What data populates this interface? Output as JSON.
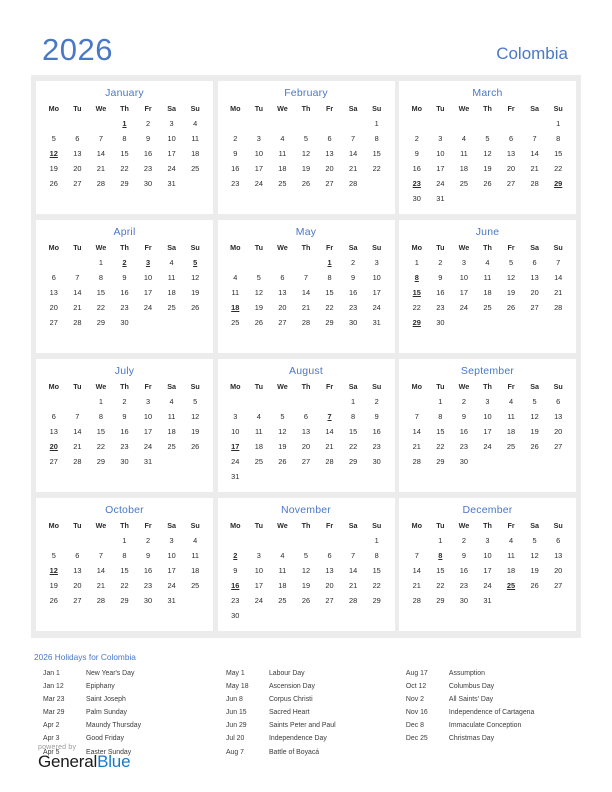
{
  "header": {
    "year": "2026",
    "country": "Colombia"
  },
  "weekdays": [
    "Mo",
    "Tu",
    "We",
    "Th",
    "Fr",
    "Sa",
    "Su"
  ],
  "months": [
    {
      "name": "January",
      "weeks": [
        [
          "",
          "",
          "",
          "1",
          "2",
          "3",
          "4"
        ],
        [
          "5",
          "6",
          "7",
          "8",
          "9",
          "10",
          "11"
        ],
        [
          "12",
          "13",
          "14",
          "15",
          "16",
          "17",
          "18"
        ],
        [
          "19",
          "20",
          "21",
          "22",
          "23",
          "24",
          "25"
        ],
        [
          "26",
          "27",
          "28",
          "29",
          "30",
          "31",
          ""
        ],
        [
          "",
          "",
          "",
          "",
          "",
          "",
          ""
        ]
      ],
      "holidays": [
        "1",
        "12"
      ]
    },
    {
      "name": "February",
      "weeks": [
        [
          "",
          "",
          "",
          "",
          "",
          "",
          "1"
        ],
        [
          "2",
          "3",
          "4",
          "5",
          "6",
          "7",
          "8"
        ],
        [
          "9",
          "10",
          "11",
          "12",
          "13",
          "14",
          "15"
        ],
        [
          "16",
          "17",
          "18",
          "19",
          "20",
          "21",
          "22"
        ],
        [
          "23",
          "24",
          "25",
          "26",
          "27",
          "28",
          ""
        ],
        [
          "",
          "",
          "",
          "",
          "",
          "",
          ""
        ]
      ],
      "holidays": []
    },
    {
      "name": "March",
      "weeks": [
        [
          "",
          "",
          "",
          "",
          "",
          "",
          "1"
        ],
        [
          "2",
          "3",
          "4",
          "5",
          "6",
          "7",
          "8"
        ],
        [
          "9",
          "10",
          "11",
          "12",
          "13",
          "14",
          "15"
        ],
        [
          "16",
          "17",
          "18",
          "19",
          "20",
          "21",
          "22"
        ],
        [
          "23",
          "24",
          "25",
          "26",
          "27",
          "28",
          "29"
        ],
        [
          "30",
          "31",
          "",
          "",
          "",
          "",
          ""
        ]
      ],
      "holidays": [
        "23",
        "29"
      ]
    },
    {
      "name": "April",
      "weeks": [
        [
          "",
          "",
          "1",
          "2",
          "3",
          "4",
          "5"
        ],
        [
          "6",
          "7",
          "8",
          "9",
          "10",
          "11",
          "12"
        ],
        [
          "13",
          "14",
          "15",
          "16",
          "17",
          "18",
          "19"
        ],
        [
          "20",
          "21",
          "22",
          "23",
          "24",
          "25",
          "26"
        ],
        [
          "27",
          "28",
          "29",
          "30",
          "",
          "",
          ""
        ],
        [
          "",
          "",
          "",
          "",
          "",
          "",
          ""
        ]
      ],
      "holidays": [
        "2",
        "3",
        "5"
      ]
    },
    {
      "name": "May",
      "weeks": [
        [
          "",
          "",
          "",
          "",
          "1",
          "2",
          "3"
        ],
        [
          "4",
          "5",
          "6",
          "7",
          "8",
          "9",
          "10"
        ],
        [
          "11",
          "12",
          "13",
          "14",
          "15",
          "16",
          "17"
        ],
        [
          "18",
          "19",
          "20",
          "21",
          "22",
          "23",
          "24"
        ],
        [
          "25",
          "26",
          "27",
          "28",
          "29",
          "30",
          "31"
        ],
        [
          "",
          "",
          "",
          "",
          "",
          "",
          ""
        ]
      ],
      "holidays": [
        "1",
        "18"
      ]
    },
    {
      "name": "June",
      "weeks": [
        [
          "1",
          "2",
          "3",
          "4",
          "5",
          "6",
          "7"
        ],
        [
          "8",
          "9",
          "10",
          "11",
          "12",
          "13",
          "14"
        ],
        [
          "15",
          "16",
          "17",
          "18",
          "19",
          "20",
          "21"
        ],
        [
          "22",
          "23",
          "24",
          "25",
          "26",
          "27",
          "28"
        ],
        [
          "29",
          "30",
          "",
          "",
          "",
          "",
          ""
        ],
        [
          "",
          "",
          "",
          "",
          "",
          "",
          ""
        ]
      ],
      "holidays": [
        "8",
        "15",
        "29"
      ]
    },
    {
      "name": "July",
      "weeks": [
        [
          "",
          "",
          "1",
          "2",
          "3",
          "4",
          "5"
        ],
        [
          "6",
          "7",
          "8",
          "9",
          "10",
          "11",
          "12"
        ],
        [
          "13",
          "14",
          "15",
          "16",
          "17",
          "18",
          "19"
        ],
        [
          "20",
          "21",
          "22",
          "23",
          "24",
          "25",
          "26"
        ],
        [
          "27",
          "28",
          "29",
          "30",
          "31",
          "",
          ""
        ],
        [
          "",
          "",
          "",
          "",
          "",
          "",
          ""
        ]
      ],
      "holidays": [
        "20"
      ]
    },
    {
      "name": "August",
      "weeks": [
        [
          "",
          "",
          "",
          "",
          "",
          "1",
          "2"
        ],
        [
          "3",
          "4",
          "5",
          "6",
          "7",
          "8",
          "9"
        ],
        [
          "10",
          "11",
          "12",
          "13",
          "14",
          "15",
          "16"
        ],
        [
          "17",
          "18",
          "19",
          "20",
          "21",
          "22",
          "23"
        ],
        [
          "24",
          "25",
          "26",
          "27",
          "28",
          "29",
          "30"
        ],
        [
          "31",
          "",
          "",
          "",
          "",
          "",
          ""
        ]
      ],
      "holidays": [
        "7",
        "17"
      ]
    },
    {
      "name": "September",
      "weeks": [
        [
          "",
          "1",
          "2",
          "3",
          "4",
          "5",
          "6"
        ],
        [
          "7",
          "8",
          "9",
          "10",
          "11",
          "12",
          "13"
        ],
        [
          "14",
          "15",
          "16",
          "17",
          "18",
          "19",
          "20"
        ],
        [
          "21",
          "22",
          "23",
          "24",
          "25",
          "26",
          "27"
        ],
        [
          "28",
          "29",
          "30",
          "",
          "",
          "",
          ""
        ],
        [
          "",
          "",
          "",
          "",
          "",
          "",
          ""
        ]
      ],
      "holidays": []
    },
    {
      "name": "October",
      "weeks": [
        [
          "",
          "",
          "",
          "1",
          "2",
          "3",
          "4"
        ],
        [
          "5",
          "6",
          "7",
          "8",
          "9",
          "10",
          "11"
        ],
        [
          "12",
          "13",
          "14",
          "15",
          "16",
          "17",
          "18"
        ],
        [
          "19",
          "20",
          "21",
          "22",
          "23",
          "24",
          "25"
        ],
        [
          "26",
          "27",
          "28",
          "29",
          "30",
          "31",
          ""
        ],
        [
          "",
          "",
          "",
          "",
          "",
          "",
          ""
        ]
      ],
      "holidays": [
        "12"
      ]
    },
    {
      "name": "November",
      "weeks": [
        [
          "",
          "",
          "",
          "",
          "",
          "",
          "1"
        ],
        [
          "2",
          "3",
          "4",
          "5",
          "6",
          "7",
          "8"
        ],
        [
          "9",
          "10",
          "11",
          "12",
          "13",
          "14",
          "15"
        ],
        [
          "16",
          "17",
          "18",
          "19",
          "20",
          "21",
          "22"
        ],
        [
          "23",
          "24",
          "25",
          "26",
          "27",
          "28",
          "29"
        ],
        [
          "30",
          "",
          "",
          "",
          "",
          "",
          ""
        ]
      ],
      "holidays": [
        "2",
        "16"
      ]
    },
    {
      "name": "December",
      "weeks": [
        [
          "",
          "1",
          "2",
          "3",
          "4",
          "5",
          "6"
        ],
        [
          "7",
          "8",
          "9",
          "10",
          "11",
          "12",
          "13"
        ],
        [
          "14",
          "15",
          "16",
          "17",
          "18",
          "19",
          "20"
        ],
        [
          "21",
          "22",
          "23",
          "24",
          "25",
          "26",
          "27"
        ],
        [
          "28",
          "29",
          "30",
          "31",
          "",
          "",
          ""
        ],
        [
          "",
          "",
          "",
          "",
          "",
          "",
          ""
        ]
      ],
      "holidays": [
        "8",
        "25"
      ]
    }
  ],
  "holiday_list": {
    "title": "2026 Holidays for Colombia",
    "columns": [
      [
        {
          "date": "Jan 1",
          "name": "New Year's Day"
        },
        {
          "date": "Jan 12",
          "name": "Epiphany"
        },
        {
          "date": "Mar 23",
          "name": "Saint Joseph"
        },
        {
          "date": "Mar 29",
          "name": "Palm Sunday"
        },
        {
          "date": "Apr 2",
          "name": "Maundy Thursday"
        },
        {
          "date": "Apr 3",
          "name": "Good Friday"
        },
        {
          "date": "Apr 5",
          "name": "Easter Sunday"
        }
      ],
      [
        {
          "date": "May 1",
          "name": "Labour Day"
        },
        {
          "date": "May 18",
          "name": "Ascension Day"
        },
        {
          "date": "Jun 8",
          "name": "Corpus Christi"
        },
        {
          "date": "Jun 15",
          "name": "Sacred Heart"
        },
        {
          "date": "Jun 29",
          "name": "Saints Peter and Paul"
        },
        {
          "date": "Jul 20",
          "name": "Independence Day"
        },
        {
          "date": "Aug 7",
          "name": "Battle of Boyacá"
        }
      ],
      [
        {
          "date": "Aug 17",
          "name": "Assumption"
        },
        {
          "date": "Oct 12",
          "name": "Columbus Day"
        },
        {
          "date": "Nov 2",
          "name": "All Saints' Day"
        },
        {
          "date": "Nov 16",
          "name": "Independence of Cartagena"
        },
        {
          "date": "Dec 8",
          "name": "Immaculate Conception"
        },
        {
          "date": "Dec 25",
          "name": "Christmas Day"
        }
      ]
    ]
  },
  "footer": {
    "powered_by": "powered by",
    "brand_first": "General",
    "brand_second": "Blue"
  },
  "colors": {
    "accent_blue": "#4a78c8",
    "holiday_red": "#e21b1b",
    "grid_background": "#ececec",
    "brand_blue": "#1878c8"
  }
}
